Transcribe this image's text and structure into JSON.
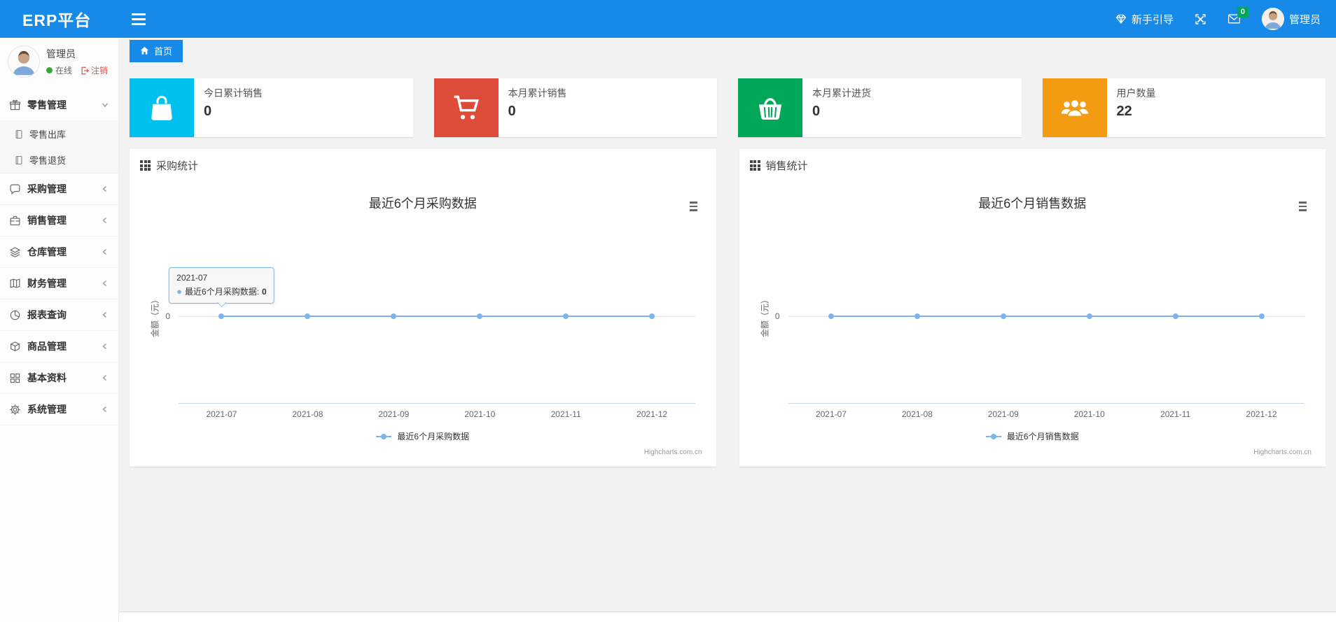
{
  "navbar": {
    "brand": "ERP平台",
    "guide_label": "新手引导",
    "mail_badge": "0",
    "user_name": "管理员",
    "bg_color": "#1789e8"
  },
  "sidebar": {
    "user": {
      "name": "管理员",
      "status_online": "在线",
      "logout_label": "注销"
    },
    "colors": {
      "online_green": "#39a639",
      "logout_red": "#d9534f"
    },
    "items": [
      {
        "label": "零售管理",
        "icon": "gift-icon",
        "expanded": true,
        "children": [
          {
            "label": "零售出库",
            "icon": "doc-icon"
          },
          {
            "label": "零售退货",
            "icon": "doc-icon"
          }
        ]
      },
      {
        "label": "采购管理",
        "icon": "comment-icon",
        "expanded": false
      },
      {
        "label": "销售管理",
        "icon": "briefcase-icon",
        "expanded": false
      },
      {
        "label": "仓库管理",
        "icon": "layers-icon",
        "expanded": false
      },
      {
        "label": "财务管理",
        "icon": "map-book-icon",
        "expanded": false
      },
      {
        "label": "报表查询",
        "icon": "pie-chart-icon",
        "expanded": false
      },
      {
        "label": "商品管理",
        "icon": "box-icon",
        "expanded": false
      },
      {
        "label": "基本资料",
        "icon": "grid-icon",
        "expanded": false
      },
      {
        "label": "系统管理",
        "icon": "gear-icon",
        "expanded": false
      }
    ]
  },
  "tabs": {
    "home": "首页"
  },
  "stat_cards": [
    {
      "label": "今日累计销售",
      "value": "0",
      "color": "#00c0ef",
      "icon": "shopping-bag-icon"
    },
    {
      "label": "本月累计销售",
      "value": "0",
      "color": "#dd4b39",
      "icon": "shopping-cart-icon"
    },
    {
      "label": "本月累计进货",
      "value": "0",
      "color": "#00a65a",
      "icon": "shopping-basket-icon"
    },
    {
      "label": "用户数量",
      "value": "22",
      "color": "#f39c12",
      "icon": "users-icon"
    }
  ],
  "panels": [
    {
      "title": "采购统计"
    },
    {
      "title": "销售统计"
    }
  ],
  "chart_data": [
    {
      "type": "line",
      "title": "最近6个月采购数据",
      "x": [
        "2021-07",
        "2021-08",
        "2021-09",
        "2021-10",
        "2021-11",
        "2021-12"
      ],
      "series": [
        {
          "name": "最近6个月采购数据",
          "values": [
            0,
            0,
            0,
            0,
            0,
            0
          ],
          "color": "#7cb5ec"
        }
      ],
      "ylabel": "金额（元）",
      "yticks": [
        "0"
      ],
      "legend_position": "bottom",
      "credits": "Highcharts.com.cn",
      "tooltip": {
        "header": "2021-07",
        "label": "最近6个月采购数据:",
        "value": "0"
      }
    },
    {
      "type": "line",
      "title": "最近6个月销售数据",
      "x": [
        "2021-07",
        "2021-08",
        "2021-09",
        "2021-10",
        "2021-11",
        "2021-12"
      ],
      "series": [
        {
          "name": "最近6个月销售数据",
          "values": [
            0,
            0,
            0,
            0,
            0,
            0
          ],
          "color": "#7cb5ec"
        }
      ],
      "ylabel": "金额（元）",
      "yticks": [
        "0"
      ],
      "legend_position": "bottom",
      "credits": "Highcharts.com.cn"
    }
  ]
}
